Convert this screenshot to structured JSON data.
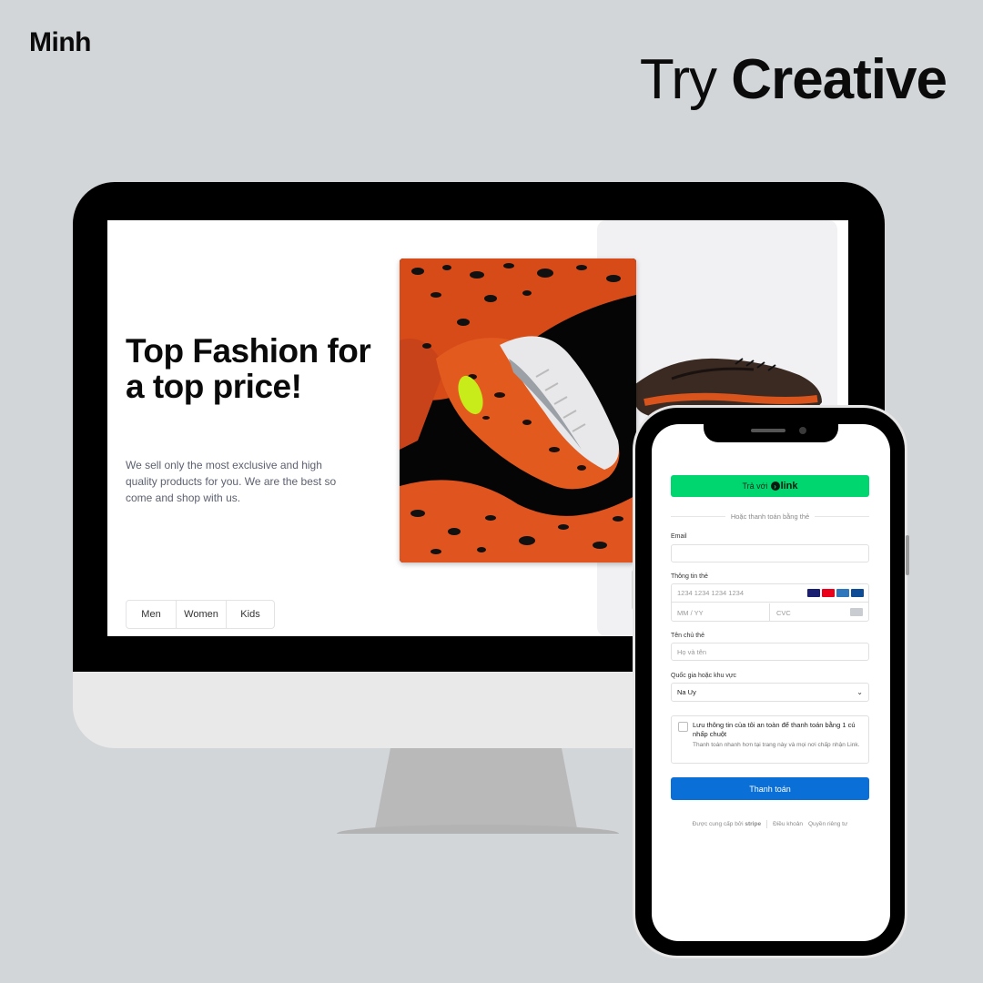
{
  "header": {
    "brand": "Minh",
    "headline_light": "Try ",
    "headline_bold": "Creative"
  },
  "hero": {
    "title": "Top Fashion for a top price!",
    "description": "We sell only the most exclusive and high quality products for you. We are the best so come and shop with us.",
    "tabs": [
      "Men",
      "Women",
      "Kids"
    ]
  },
  "checkout": {
    "link_button_prefix": "Trả với",
    "link_logo": "link",
    "divider": "Hoặc thanh toán bằng thẻ",
    "email_label": "Email",
    "email_value": "",
    "card_label": "Thông tin thẻ",
    "card_number_placeholder": "1234 1234 1234 1234",
    "expiry_placeholder": "MM / YY",
    "cvc_placeholder": "CVC",
    "card_brands": [
      {
        "name": "visa",
        "color": "#1a1f71"
      },
      {
        "name": "mastercard",
        "color": "#eb001b"
      },
      {
        "name": "amex",
        "color": "#2e77bc"
      },
      {
        "name": "jcb",
        "color": "#0e4c96"
      }
    ],
    "holder_label": "Tên chủ thẻ",
    "holder_placeholder": "Họ và tên",
    "country_label": "Quốc gia hoặc khu vực",
    "country_value": "Na Uy",
    "save_title": "Lưu thông tin của tôi an toàn để thanh toán bằng 1 cú nhấp chuột",
    "save_subtitle": "Thanh toán nhanh hơn tại trang này và mọi nơi chấp nhận Link.",
    "pay_button": "Thanh toán",
    "footer_powered": "Được cung cấp bởi",
    "footer_brand": "stripe",
    "footer_terms": "Điều khoản",
    "footer_privacy": "Quyền riêng tư"
  },
  "colors": {
    "background": "#d2d6d9",
    "link_green": "#00d66f",
    "pay_blue": "#0a6fd6",
    "shoe_orange": "#e0551f"
  }
}
